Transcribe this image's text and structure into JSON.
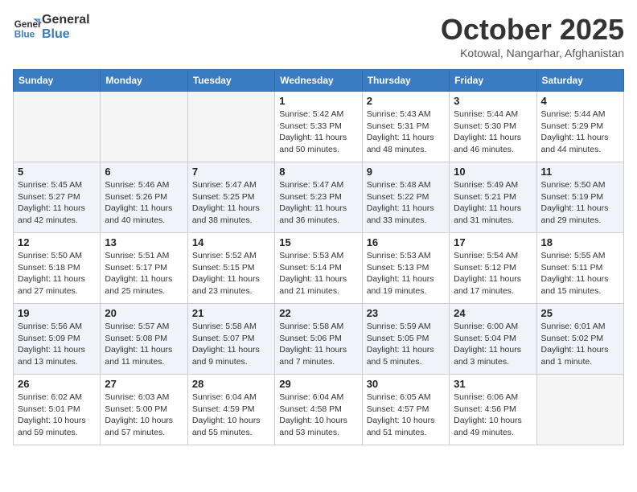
{
  "header": {
    "logo_line1": "General",
    "logo_line2": "Blue",
    "month": "October 2025",
    "location": "Kotowal, Nangarhar, Afghanistan"
  },
  "days_of_week": [
    "Sunday",
    "Monday",
    "Tuesday",
    "Wednesday",
    "Thursday",
    "Friday",
    "Saturday"
  ],
  "weeks": [
    [
      {
        "day": "",
        "info": ""
      },
      {
        "day": "",
        "info": ""
      },
      {
        "day": "",
        "info": ""
      },
      {
        "day": "1",
        "info": "Sunrise: 5:42 AM\nSunset: 5:33 PM\nDaylight: 11 hours\nand 50 minutes."
      },
      {
        "day": "2",
        "info": "Sunrise: 5:43 AM\nSunset: 5:31 PM\nDaylight: 11 hours\nand 48 minutes."
      },
      {
        "day": "3",
        "info": "Sunrise: 5:44 AM\nSunset: 5:30 PM\nDaylight: 11 hours\nand 46 minutes."
      },
      {
        "day": "4",
        "info": "Sunrise: 5:44 AM\nSunset: 5:29 PM\nDaylight: 11 hours\nand 44 minutes."
      }
    ],
    [
      {
        "day": "5",
        "info": "Sunrise: 5:45 AM\nSunset: 5:27 PM\nDaylight: 11 hours\nand 42 minutes."
      },
      {
        "day": "6",
        "info": "Sunrise: 5:46 AM\nSunset: 5:26 PM\nDaylight: 11 hours\nand 40 minutes."
      },
      {
        "day": "7",
        "info": "Sunrise: 5:47 AM\nSunset: 5:25 PM\nDaylight: 11 hours\nand 38 minutes."
      },
      {
        "day": "8",
        "info": "Sunrise: 5:47 AM\nSunset: 5:23 PM\nDaylight: 11 hours\nand 36 minutes."
      },
      {
        "day": "9",
        "info": "Sunrise: 5:48 AM\nSunset: 5:22 PM\nDaylight: 11 hours\nand 33 minutes."
      },
      {
        "day": "10",
        "info": "Sunrise: 5:49 AM\nSunset: 5:21 PM\nDaylight: 11 hours\nand 31 minutes."
      },
      {
        "day": "11",
        "info": "Sunrise: 5:50 AM\nSunset: 5:19 PM\nDaylight: 11 hours\nand 29 minutes."
      }
    ],
    [
      {
        "day": "12",
        "info": "Sunrise: 5:50 AM\nSunset: 5:18 PM\nDaylight: 11 hours\nand 27 minutes."
      },
      {
        "day": "13",
        "info": "Sunrise: 5:51 AM\nSunset: 5:17 PM\nDaylight: 11 hours\nand 25 minutes."
      },
      {
        "day": "14",
        "info": "Sunrise: 5:52 AM\nSunset: 5:15 PM\nDaylight: 11 hours\nand 23 minutes."
      },
      {
        "day": "15",
        "info": "Sunrise: 5:53 AM\nSunset: 5:14 PM\nDaylight: 11 hours\nand 21 minutes."
      },
      {
        "day": "16",
        "info": "Sunrise: 5:53 AM\nSunset: 5:13 PM\nDaylight: 11 hours\nand 19 minutes."
      },
      {
        "day": "17",
        "info": "Sunrise: 5:54 AM\nSunset: 5:12 PM\nDaylight: 11 hours\nand 17 minutes."
      },
      {
        "day": "18",
        "info": "Sunrise: 5:55 AM\nSunset: 5:11 PM\nDaylight: 11 hours\nand 15 minutes."
      }
    ],
    [
      {
        "day": "19",
        "info": "Sunrise: 5:56 AM\nSunset: 5:09 PM\nDaylight: 11 hours\nand 13 minutes."
      },
      {
        "day": "20",
        "info": "Sunrise: 5:57 AM\nSunset: 5:08 PM\nDaylight: 11 hours\nand 11 minutes."
      },
      {
        "day": "21",
        "info": "Sunrise: 5:58 AM\nSunset: 5:07 PM\nDaylight: 11 hours\nand 9 minutes."
      },
      {
        "day": "22",
        "info": "Sunrise: 5:58 AM\nSunset: 5:06 PM\nDaylight: 11 hours\nand 7 minutes."
      },
      {
        "day": "23",
        "info": "Sunrise: 5:59 AM\nSunset: 5:05 PM\nDaylight: 11 hours\nand 5 minutes."
      },
      {
        "day": "24",
        "info": "Sunrise: 6:00 AM\nSunset: 5:04 PM\nDaylight: 11 hours\nand 3 minutes."
      },
      {
        "day": "25",
        "info": "Sunrise: 6:01 AM\nSunset: 5:02 PM\nDaylight: 11 hours\nand 1 minute."
      }
    ],
    [
      {
        "day": "26",
        "info": "Sunrise: 6:02 AM\nSunset: 5:01 PM\nDaylight: 10 hours\nand 59 minutes."
      },
      {
        "day": "27",
        "info": "Sunrise: 6:03 AM\nSunset: 5:00 PM\nDaylight: 10 hours\nand 57 minutes."
      },
      {
        "day": "28",
        "info": "Sunrise: 6:04 AM\nSunset: 4:59 PM\nDaylight: 10 hours\nand 55 minutes."
      },
      {
        "day": "29",
        "info": "Sunrise: 6:04 AM\nSunset: 4:58 PM\nDaylight: 10 hours\nand 53 minutes."
      },
      {
        "day": "30",
        "info": "Sunrise: 6:05 AM\nSunset: 4:57 PM\nDaylight: 10 hours\nand 51 minutes."
      },
      {
        "day": "31",
        "info": "Sunrise: 6:06 AM\nSunset: 4:56 PM\nDaylight: 10 hours\nand 49 minutes."
      },
      {
        "day": "",
        "info": ""
      }
    ]
  ]
}
